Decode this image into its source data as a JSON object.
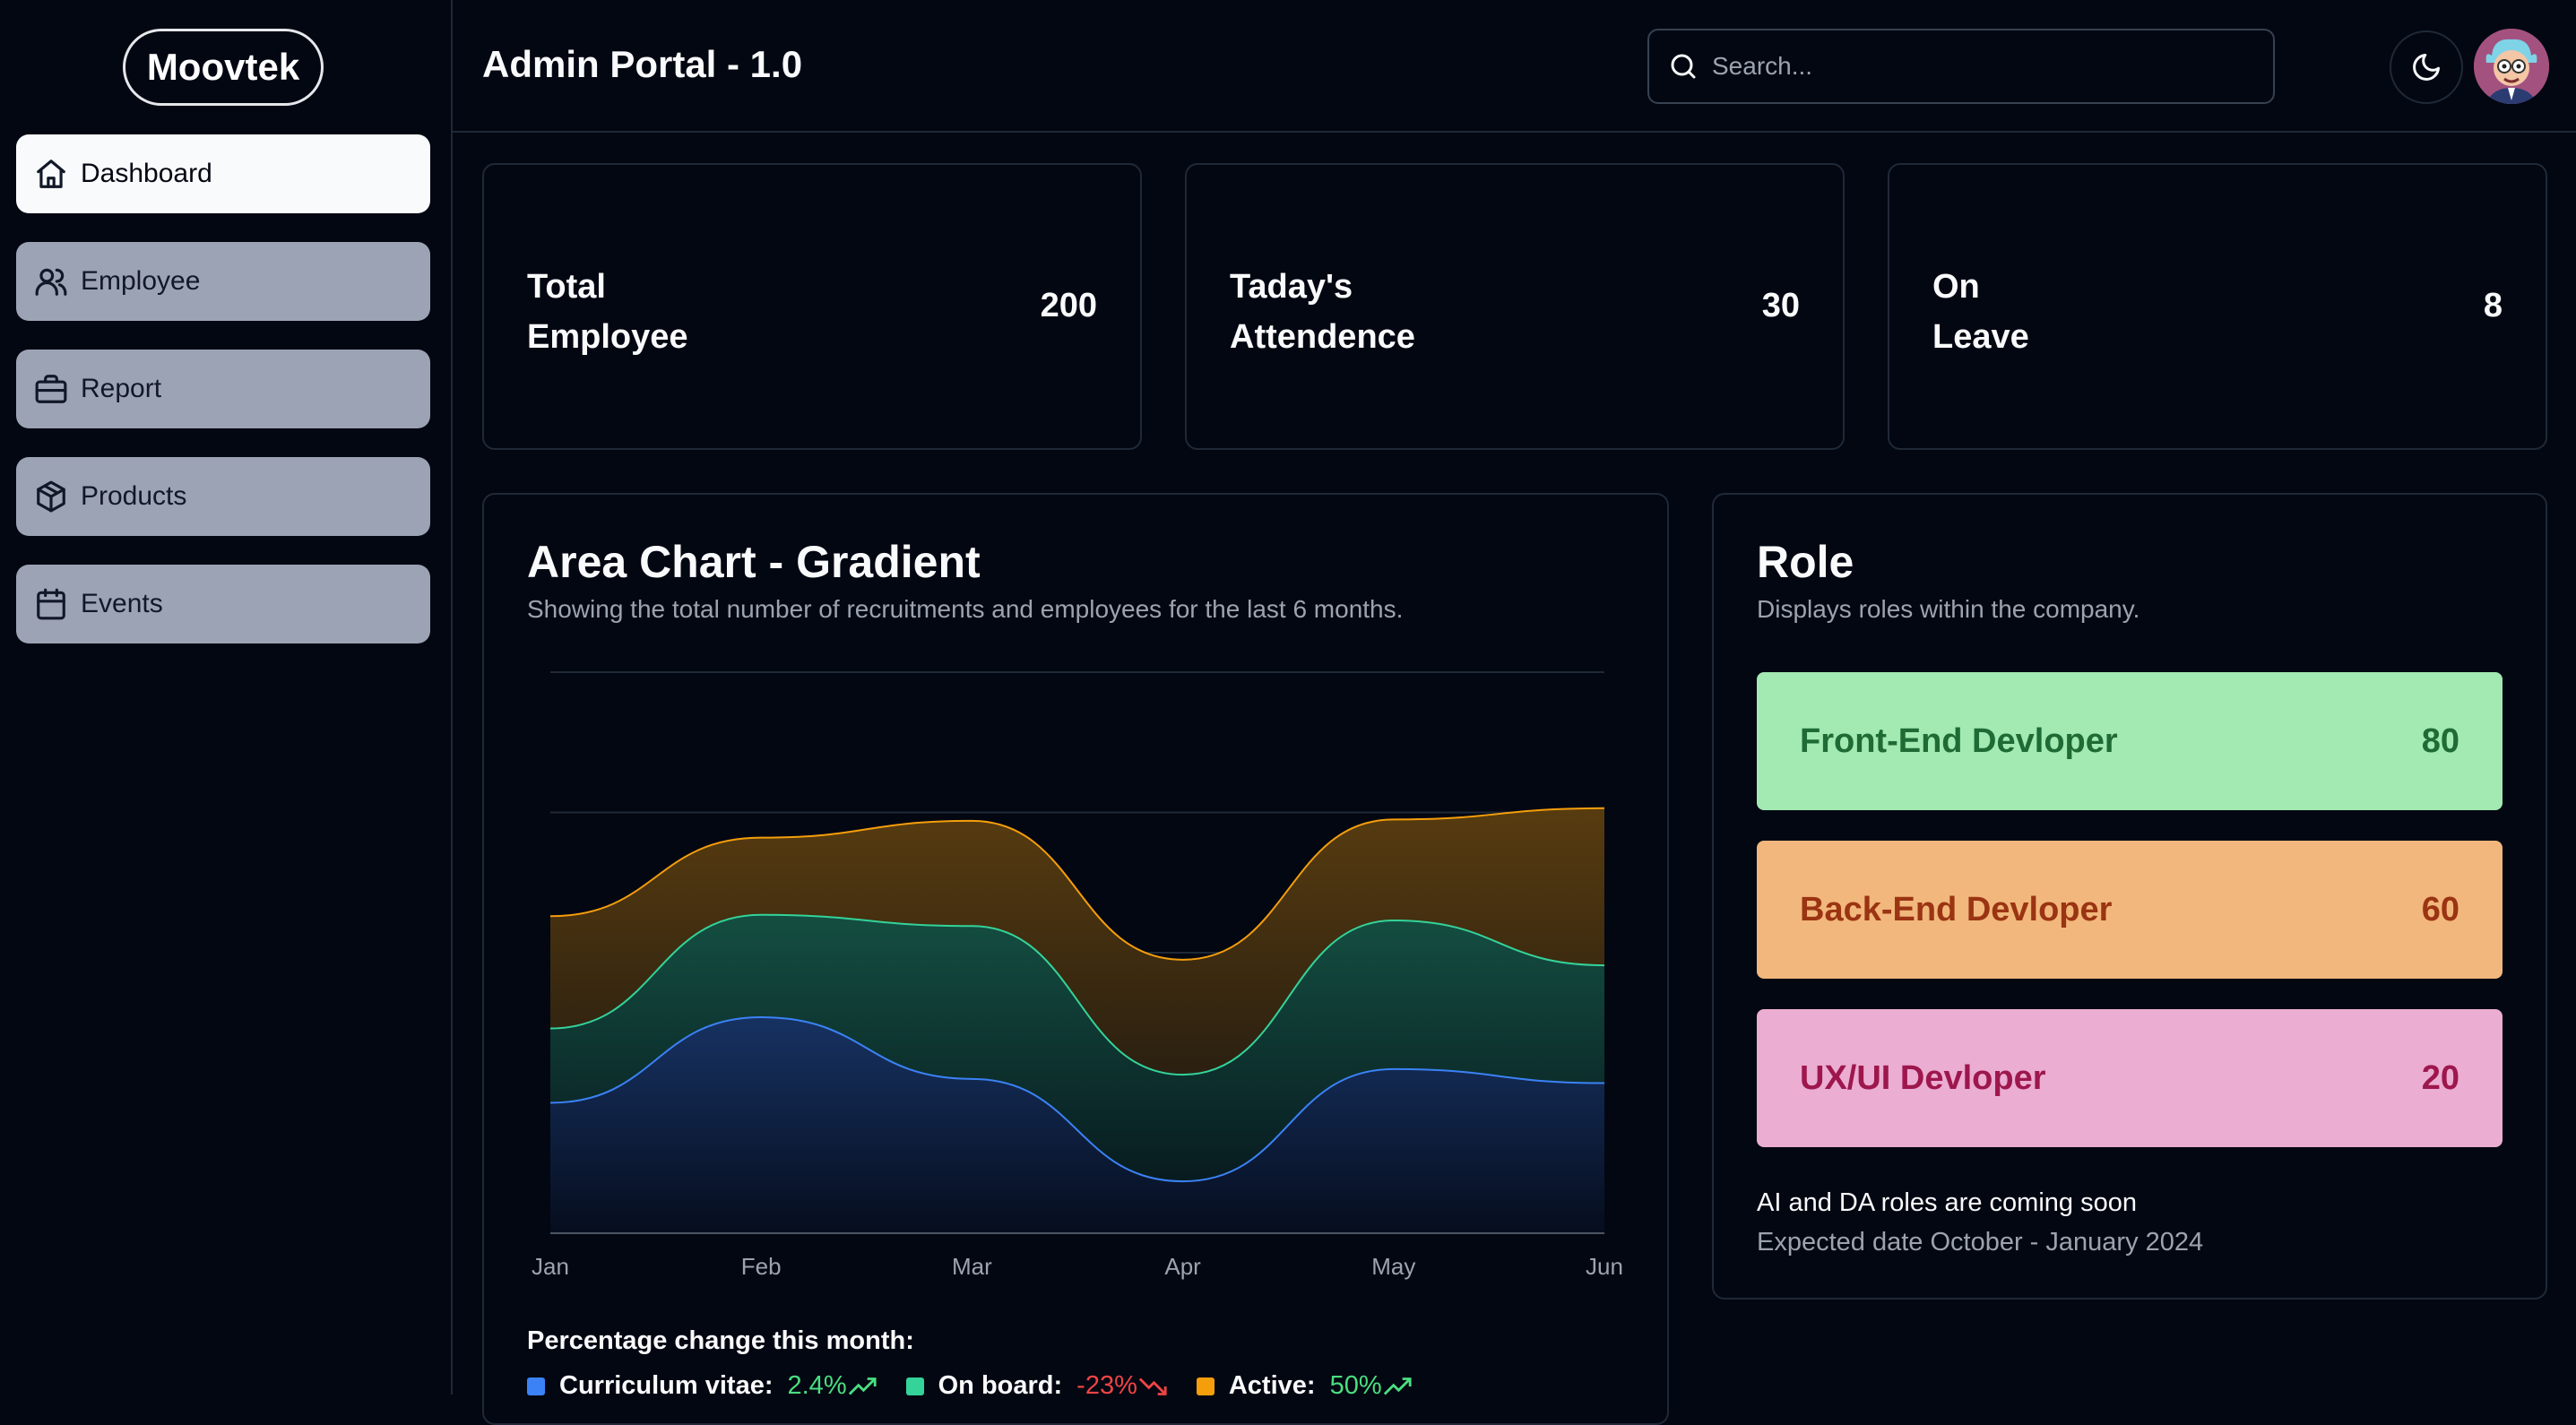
{
  "app": {
    "logo": "Moovtek",
    "title": "Admin Portal - 1.0"
  },
  "sidebar": {
    "items": [
      {
        "label": "Dashboard",
        "icon": "home-icon",
        "active": true
      },
      {
        "label": "Employee",
        "icon": "users-icon",
        "active": false
      },
      {
        "label": "Report",
        "icon": "briefcase-icon",
        "active": false
      },
      {
        "label": "Products",
        "icon": "package-icon",
        "active": false
      },
      {
        "label": "Events",
        "icon": "calendar-icon",
        "active": false
      }
    ]
  },
  "header": {
    "search_placeholder": "Search...",
    "theme_icon": "moon-icon",
    "avatar_icon": "avatar-icon"
  },
  "stats": [
    {
      "label": "Total Employee",
      "value": "200"
    },
    {
      "label": "Taday's Attendence",
      "value": "30"
    },
    {
      "label": "On Leave",
      "value": "8"
    }
  ],
  "chart": {
    "title": "Area Chart - Gradient",
    "description": "Showing the total number of recruitments and employees for the last 6 months.",
    "percent_title": "Percentage change this month:",
    "percent_items": [
      {
        "label": "Curriculum vitae:",
        "value": "2.4%",
        "color": "#3b82f6",
        "value_color": "#4ade80",
        "trend": "up"
      },
      {
        "label": "On board:",
        "value": "-23%",
        "color": "#34d399",
        "value_color": "#ef4444",
        "trend": "down"
      },
      {
        "label": "Active:",
        "value": "50%",
        "color": "#f59e0b",
        "value_color": "#4ade80",
        "trend": "up"
      }
    ]
  },
  "chart_data": {
    "type": "area",
    "title": "Area Chart - Gradient",
    "categories": [
      "Jan",
      "Feb",
      "Mar",
      "Apr",
      "May",
      "Jun"
    ],
    "stacked": true,
    "grid": "horizontal",
    "ylim": [
      0,
      400
    ],
    "series": [
      {
        "values": [
          93,
          154,
          110,
          37,
          117,
          107
        ],
        "color": "#3b82f6"
      },
      {
        "values": [
          53,
          73,
          109,
          76,
          106,
          84
        ],
        "color": "#34d399"
      },
      {
        "values": [
          80,
          55,
          75,
          82,
          72,
          112
        ],
        "color": "#f59e0b"
      }
    ]
  },
  "roles": {
    "title": "Role",
    "description": "Displays roles within the company.",
    "items": [
      {
        "label": "Front-End Devloper",
        "value": "80",
        "bg": "#a3e9b2",
        "fg": "#1f6b36"
      },
      {
        "label": "Back-End Devloper",
        "value": "60",
        "bg": "#f2b77c",
        "fg": "#9a3412"
      },
      {
        "label": "UX/UI Devloper",
        "value": "20",
        "bg": "#ebadd2",
        "fg": "#9d174d"
      }
    ],
    "note": "AI and DA roles are coming soon",
    "subnote": "Expected date October - January 2024"
  }
}
